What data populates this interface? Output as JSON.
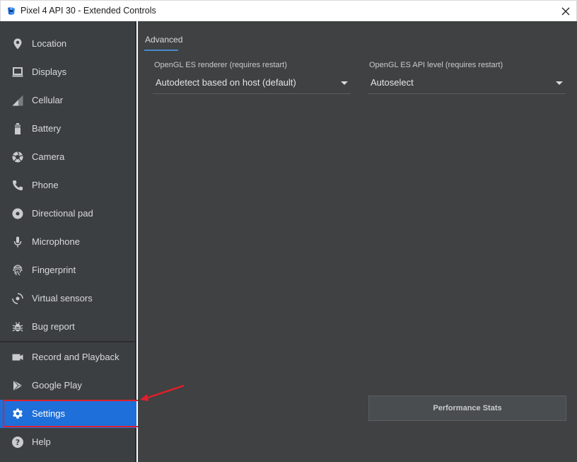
{
  "window": {
    "title": "Pixel 4 API 30 - Extended Controls"
  },
  "sidebar": {
    "items": [
      {
        "label": "Location",
        "icon": "location-pin-icon"
      },
      {
        "label": "Displays",
        "icon": "display-icon"
      },
      {
        "label": "Cellular",
        "icon": "cellular-signal-icon"
      },
      {
        "label": "Battery",
        "icon": "battery-icon"
      },
      {
        "label": "Camera",
        "icon": "camera-aperture-icon"
      },
      {
        "label": "Phone",
        "icon": "phone-icon"
      },
      {
        "label": "Directional pad",
        "icon": "dpad-icon"
      },
      {
        "label": "Microphone",
        "icon": "microphone-icon"
      },
      {
        "label": "Fingerprint",
        "icon": "fingerprint-icon"
      },
      {
        "label": "Virtual sensors",
        "icon": "rotate-sensor-icon"
      },
      {
        "label": "Bug report",
        "icon": "bug-icon"
      }
    ],
    "bottom_items": [
      {
        "label": "Record and Playback",
        "icon": "video-camera-icon"
      },
      {
        "label": "Google Play",
        "icon": "play-store-icon"
      },
      {
        "label": "Settings",
        "icon": "gear-icon",
        "selected": true
      },
      {
        "label": "Help",
        "icon": "help-icon"
      }
    ]
  },
  "main": {
    "tabs": [
      {
        "label": "Advanced",
        "active": true
      }
    ],
    "renderer": {
      "label": "OpenGL ES renderer (requires restart)",
      "value": "Autodetect based on host (default)"
    },
    "api_level": {
      "label": "OpenGL ES API level (requires restart)",
      "value": "Autoselect"
    },
    "performance_button": "Performance Stats"
  },
  "colors": {
    "sidebar_bg": "#3c3f41",
    "main_bg": "#3f4142",
    "selected": "#1e6fd9",
    "annotation": "#e0202a",
    "tab_accent": "#4a88c7"
  }
}
